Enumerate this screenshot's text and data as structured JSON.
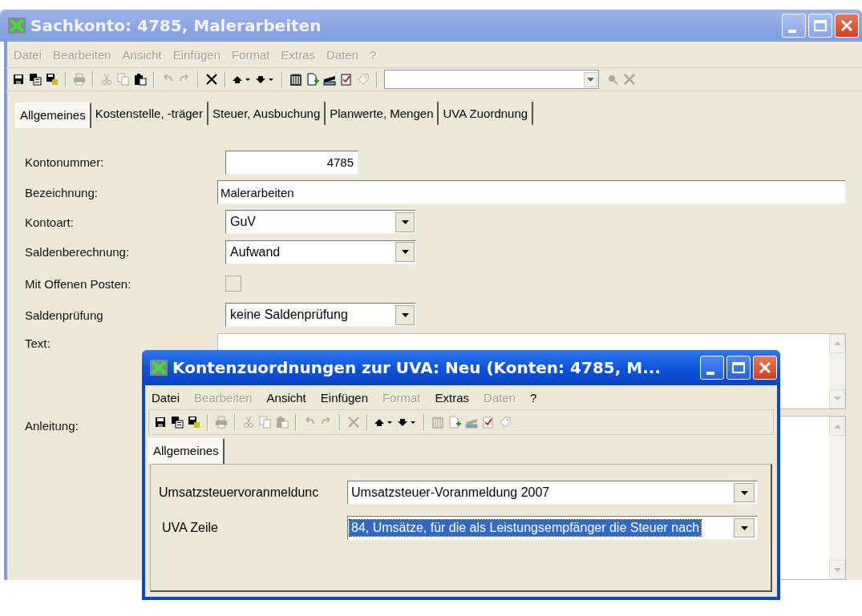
{
  "window": {
    "title": "Sachkonto: 4785, Malerarbeiten",
    "active": false
  },
  "menu": [
    "Datei",
    "Bearbeiten",
    "Ansicht",
    "Einfügen",
    "Format",
    "Extras",
    "Daten",
    "?"
  ],
  "toolbar": [
    {
      "kind": "save",
      "disabled": false
    },
    {
      "kind": "saveas",
      "disabled": false
    },
    {
      "kind": "saveclose",
      "disabled": false
    },
    {
      "kind": "sep"
    },
    {
      "kind": "print",
      "disabled": true
    },
    {
      "kind": "sep"
    },
    {
      "kind": "cut",
      "disabled": true
    },
    {
      "kind": "copy",
      "disabled": true
    },
    {
      "kind": "paste",
      "disabled": false
    },
    {
      "kind": "sep"
    },
    {
      "kind": "undo",
      "disabled": true
    },
    {
      "kind": "redo",
      "disabled": true
    },
    {
      "kind": "sep"
    },
    {
      "kind": "delete",
      "disabled": false
    },
    {
      "kind": "sep"
    },
    {
      "kind": "up",
      "disabled": false
    },
    {
      "kind": "down",
      "disabled": false
    },
    {
      "kind": "sep"
    },
    {
      "kind": "attach",
      "disabled": false
    },
    {
      "kind": "newdoc",
      "disabled": false
    },
    {
      "kind": "scan",
      "disabled": false
    },
    {
      "kind": "check",
      "disabled": false
    },
    {
      "kind": "tag",
      "disabled": true
    }
  ],
  "tabs": [
    {
      "label": "Allgemeines",
      "selected": true
    },
    {
      "label": "Kostenstelle, -träger",
      "selected": false
    },
    {
      "label": "Steuer, Ausbuchung",
      "selected": false
    },
    {
      "label": "Planwerte, Mengen",
      "selected": false
    },
    {
      "label": "UVA Zuordnung",
      "selected": false
    }
  ],
  "fields": [
    {
      "kind": "number",
      "label": "Kontonummer:",
      "value": "4785"
    },
    {
      "kind": "text",
      "label": "Bezeichnung:",
      "value": "Malerarbeiten"
    },
    {
      "kind": "combo",
      "label": "Kontoart:",
      "value": "GuV"
    },
    {
      "kind": "combo",
      "label": "Saldenberechnung:",
      "value": "Aufwand"
    },
    {
      "kind": "checkbox",
      "label": "Mit Offenen Posten:",
      "checked": false
    },
    {
      "kind": "combo",
      "label": "Saldenprüfung",
      "value": "keine Saldenprüfung"
    },
    {
      "kind": "textarea",
      "label": "Text:"
    },
    {
      "kind": "textarea",
      "label": "Anleitung:"
    }
  ],
  "dialog": {
    "title": "Kontenzuordnungen zur UVA: Neu (Konten: 4785, M...",
    "active": true,
    "menu": [
      {
        "label": "Datei",
        "disabled": false
      },
      {
        "label": "Bearbeiten",
        "disabled": true
      },
      {
        "label": "Ansicht",
        "disabled": false
      },
      {
        "label": "Einfügen",
        "disabled": false
      },
      {
        "label": "Format",
        "disabled": true
      },
      {
        "label": "Extras",
        "disabled": false
      },
      {
        "label": "Daten",
        "disabled": true
      },
      {
        "label": "?",
        "disabled": false
      }
    ],
    "toolbar": [
      {
        "kind": "save",
        "disabled": false
      },
      {
        "kind": "saveas",
        "disabled": false
      },
      {
        "kind": "saveclose",
        "disabled": false
      },
      {
        "kind": "sep"
      },
      {
        "kind": "print",
        "disabled": true
      },
      {
        "kind": "sep"
      },
      {
        "kind": "cut",
        "disabled": true
      },
      {
        "kind": "copy",
        "disabled": true
      },
      {
        "kind": "paste",
        "disabled": true
      },
      {
        "kind": "sep"
      },
      {
        "kind": "undo",
        "disabled": true
      },
      {
        "kind": "redo",
        "disabled": true
      },
      {
        "kind": "sep"
      },
      {
        "kind": "delete",
        "disabled": true
      },
      {
        "kind": "sep"
      },
      {
        "kind": "up",
        "disabled": false
      },
      {
        "kind": "down",
        "disabled": false
      },
      {
        "kind": "sep"
      },
      {
        "kind": "attach",
        "disabled": true
      },
      {
        "kind": "newdoc",
        "disabled": true
      },
      {
        "kind": "scan",
        "disabled": true
      },
      {
        "kind": "check",
        "disabled": true
      },
      {
        "kind": "tag",
        "disabled": true
      }
    ],
    "tabs": [
      {
        "label": "Allgemeines",
        "selected": true
      }
    ],
    "fields": [
      {
        "label": "Umsatzsteuervoranmeldunc",
        "value": "Umsatzsteuer-Voranmeldung 2007",
        "selected": false
      },
      {
        "label": "UVA Zeile",
        "value": "84, Umsätze, für die als Leistungsempfänger die Steuer nach",
        "selected": true
      }
    ]
  }
}
